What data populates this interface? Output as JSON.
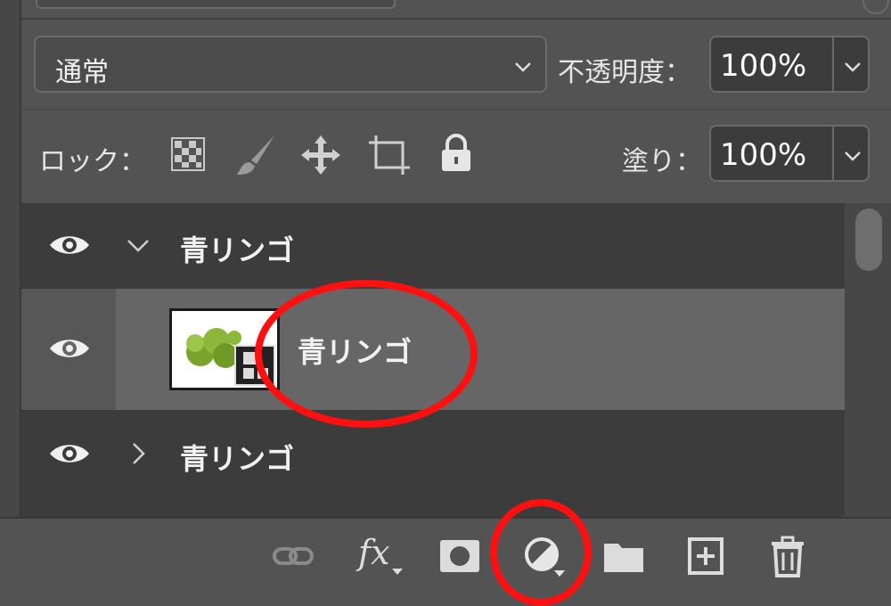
{
  "blend": {
    "mode": "通常",
    "opacity_label": "不透明度：",
    "opacity_value": "100%"
  },
  "lock": {
    "label": "ロック：",
    "fill_label": "塗り：",
    "fill_value": "100%",
    "icons": [
      "lock-transparent-pixels-icon",
      "lock-image-pixels-icon",
      "lock-position-icon",
      "lock-artboard-icon",
      "lock-all-icon"
    ]
  },
  "layers": [
    {
      "name": "青リンゴ",
      "type": "group",
      "expanded": true,
      "visible": true
    },
    {
      "name": "青リンゴ",
      "type": "smart-object",
      "selected": true,
      "visible": true
    },
    {
      "name": "青リンゴ",
      "type": "group",
      "expanded": false,
      "visible": true
    }
  ],
  "toolbar": {
    "icons": [
      "link-layers-icon",
      "fx-icon",
      "add-mask-icon",
      "adjustment-layer-icon",
      "new-group-icon",
      "new-layer-icon",
      "delete-layer-icon"
    ],
    "fx_label": "fx"
  },
  "colors": {
    "panel_bg": "#535353",
    "layers_bg": "#3c3c3c",
    "selected_row": "#666666",
    "annotation": "#ff1010"
  }
}
